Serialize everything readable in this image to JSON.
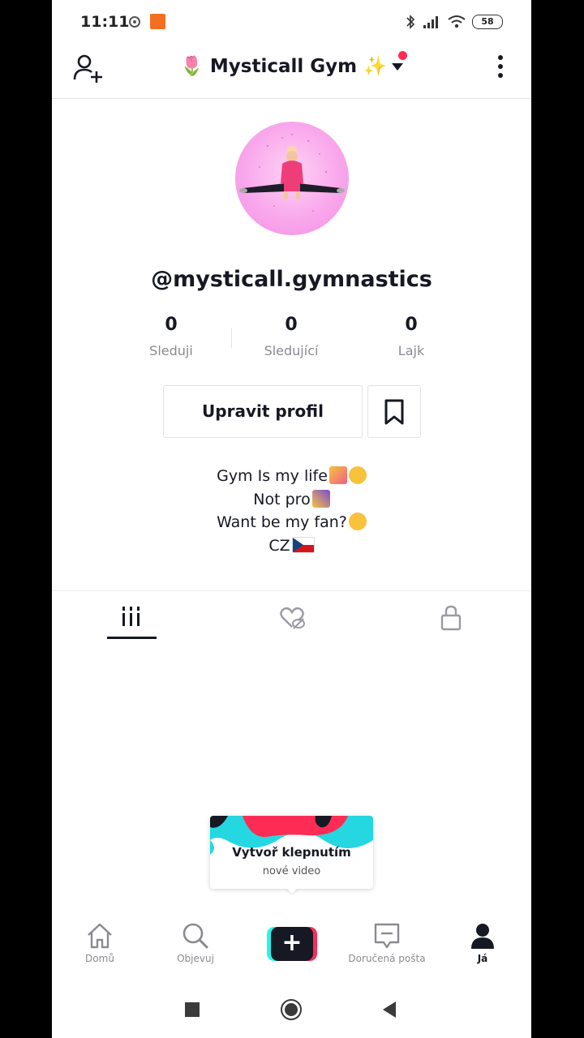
{
  "status_bar": {
    "time": "11:11",
    "battery": "58"
  },
  "header": {
    "title": "🌷 Mysticall Gym ✨"
  },
  "profile": {
    "username": "@mysticall.gymnastics",
    "stats": [
      {
        "value": "0",
        "label": "Sleduji"
      },
      {
        "value": "0",
        "label": "Sledující"
      },
      {
        "value": "0",
        "label": "Lajk"
      }
    ],
    "edit_label": "Upravit profil",
    "bio": [
      "Gym Is my life",
      "Not pro",
      "Want be my fan?",
      "CZ"
    ]
  },
  "tooltip": {
    "title": "Vytvoř klepnutím",
    "subtitle": "nové video"
  },
  "nav": {
    "items": [
      {
        "label": "Domů"
      },
      {
        "label": "Objevuj"
      },
      {
        "label": "+"
      },
      {
        "label": "Doručená pošta"
      },
      {
        "label": "Já"
      }
    ]
  },
  "colors": {
    "accent": "#fe2c55",
    "cyan": "#25f4ee",
    "text": "#161823",
    "muted": "#8a8b91",
    "avatar_bg": "#f9a8ec"
  }
}
